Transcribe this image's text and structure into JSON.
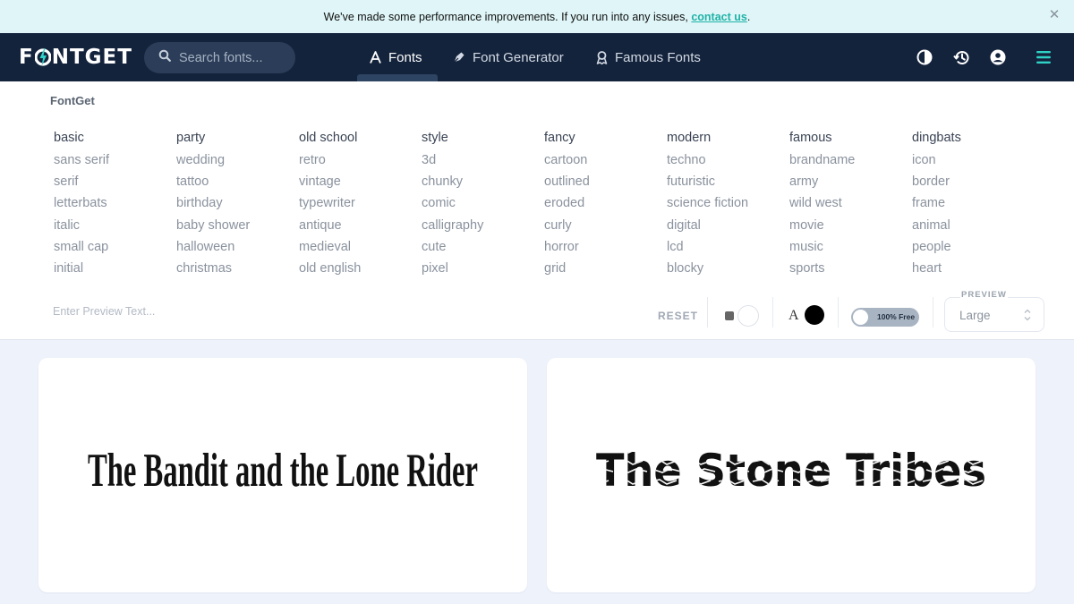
{
  "announcement": {
    "text": "We've made some performance improvements. If you run into any issues, ",
    "link": "contact us",
    "suffix": ".",
    "close_icon": "close-icon"
  },
  "header": {
    "logo": {
      "before": "F",
      "after": "NTGET"
    },
    "search": {
      "placeholder": "Search fonts..."
    },
    "nav": [
      {
        "label": "Fonts",
        "icon": "font-a-icon",
        "active": true
      },
      {
        "label": "Font Generator",
        "icon": "pen-nib-icon",
        "active": false
      },
      {
        "label": "Famous Fonts",
        "icon": "award-icon",
        "active": false
      }
    ],
    "icons": [
      "contrast-icon",
      "history-icon",
      "user-icon",
      "menu-icon"
    ]
  },
  "panel": {
    "brand": "FontGet",
    "categories": [
      {
        "title": "basic",
        "items": [
          "sans serif",
          "serif",
          "letterbats",
          "italic",
          "small cap",
          "initial"
        ]
      },
      {
        "title": "party",
        "items": [
          "wedding",
          "tattoo",
          "birthday",
          "baby shower",
          "halloween",
          "christmas"
        ]
      },
      {
        "title": "old school",
        "items": [
          "retro",
          "vintage",
          "typewriter",
          "antique",
          "medieval",
          "old english"
        ]
      },
      {
        "title": "style",
        "items": [
          "3d",
          "chunky",
          "comic",
          "calligraphy",
          "cute",
          "pixel"
        ]
      },
      {
        "title": "fancy",
        "items": [
          "cartoon",
          "outlined",
          "eroded",
          "curly",
          "horror",
          "grid"
        ]
      },
      {
        "title": "modern",
        "items": [
          "techno",
          "futuristic",
          "science fiction",
          "digital",
          "lcd",
          "blocky"
        ]
      },
      {
        "title": "famous",
        "items": [
          "brandname",
          "army",
          "wild west",
          "movie",
          "music",
          "sports"
        ]
      },
      {
        "title": "dingbats",
        "items": [
          "icon",
          "border",
          "frame",
          "animal",
          "people",
          "heart"
        ]
      }
    ],
    "controls": {
      "preview_placeholder": "Enter Preview Text...",
      "reset_label": "RESET",
      "bg_color": "#ffffff",
      "text_icon": "A",
      "text_color": "#000000",
      "free_toggle_label": "100% Free",
      "free_toggle_on": false,
      "preview_size_label": "PREVIEW",
      "preview_size_value": "Large"
    }
  },
  "cards": [
    {
      "preview_text": "The Bandit and the Lone Rider"
    },
    {
      "preview_text": "The Stone Tribes"
    }
  ],
  "colors": {
    "header_bg": "#14233c",
    "accent": "#1fb3a8",
    "announce_bg": "#dff5f7",
    "page_bg": "#eef2fa"
  }
}
